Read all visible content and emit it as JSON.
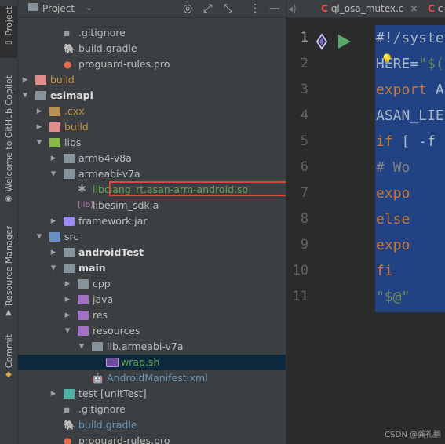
{
  "toolstrip": {
    "project": "Project",
    "copilot": "Welcome to GitHub Copilot",
    "resource_manager": "Resource Manager",
    "commit": "Commit"
  },
  "panel": {
    "title": "Project"
  },
  "tree": [
    {
      "label": "gitignore",
      "label_prefix": ".",
      "arrow": "",
      "icon": "text-file",
      "style": ""
    },
    {
      "label": "build.gradle",
      "arrow": "",
      "icon": "gradle",
      "style": ""
    },
    {
      "label": "proguard-rules.pro",
      "arrow": "",
      "icon": "proguard",
      "style": ""
    },
    {
      "label": "build",
      "arrow": "right",
      "icon": "folder-red",
      "style": "orange"
    },
    {
      "label": "esimapi",
      "arrow": "down",
      "icon": "module",
      "style": "bold"
    },
    {
      "label": ".cxx",
      "arrow": "right",
      "icon": "folder-orange",
      "style": "orange"
    },
    {
      "label": "build",
      "arrow": "right",
      "icon": "folder-red",
      "style": "orange"
    },
    {
      "label": "libs",
      "arrow": "down",
      "icon": "folder-green",
      "style": ""
    },
    {
      "label": "arm64-v8a",
      "arrow": "right",
      "icon": "folder",
      "style": ""
    },
    {
      "label": "armeabi-v7a",
      "arrow": "down",
      "icon": "folder",
      "style": ""
    },
    {
      "label": "libclang_rt.asan-arm-android.so",
      "arrow": "",
      "icon": "so-file",
      "style": "green"
    },
    {
      "label": "libesim_sdk.a",
      "arrow": "",
      "icon": "lib-file",
      "style": ""
    },
    {
      "label": "framework.jar",
      "arrow": "right",
      "icon": "jar",
      "style": ""
    },
    {
      "label": "src",
      "arrow": "down",
      "icon": "folder-blue",
      "style": ""
    },
    {
      "label": "androidTest",
      "arrow": "right",
      "icon": "folder",
      "style": "bold"
    },
    {
      "label": "main",
      "arrow": "down",
      "icon": "folder",
      "style": "bold"
    },
    {
      "label": "cpp",
      "arrow": "right",
      "icon": "folder",
      "style": ""
    },
    {
      "label": "java",
      "arrow": "right",
      "icon": "folder-purple",
      "style": ""
    },
    {
      "label": "res",
      "arrow": "right",
      "icon": "folder-purple",
      "style": ""
    },
    {
      "label": "resources",
      "arrow": "down",
      "icon": "folder-purple",
      "style": ""
    },
    {
      "label": "lib.armeabi-v7a",
      "arrow": "down",
      "icon": "folder",
      "style": ""
    },
    {
      "label": "wrap.sh",
      "arrow": "",
      "icon": "shell",
      "style": "green",
      "selected": true
    },
    {
      "label": "AndroidManifest.xml",
      "arrow": "",
      "icon": "android",
      "style": "blue"
    },
    {
      "label": "test [unitTest]",
      "arrow": "right",
      "icon": "folder-teal",
      "style": ""
    },
    {
      "label": "gitignore",
      "label_prefix": ".",
      "arrow": "",
      "icon": "text-file",
      "style": ""
    },
    {
      "label": "build.gradle",
      "arrow": "",
      "icon": "gradle",
      "style": "blue"
    },
    {
      "label": "proguard-rules.pro",
      "arrow": "",
      "icon": "proguard",
      "style": ""
    }
  ],
  "editor": {
    "tabs": [
      {
        "label": "ql_osa_mutex.c",
        "icon": "C"
      },
      {
        "label": "c",
        "icon": "C"
      }
    ],
    "line_numbers": [
      "1",
      "2",
      "3",
      "4",
      "5",
      "6",
      "7",
      "8",
      "9",
      "10",
      "11"
    ],
    "code": [
      "#!/syste",
      "HERE=\"$(",
      "export A",
      "ASAN_LIE",
      "if [ -f",
      "    # Wo",
      "    expo",
      "else",
      "    expo",
      "fi",
      "\"$@\""
    ],
    "watermark": "CSDN @龚礼鹏"
  },
  "colors": {
    "selection_border": "#e0443c",
    "selected_row": "#0d293e",
    "code_selection": "#214283"
  }
}
